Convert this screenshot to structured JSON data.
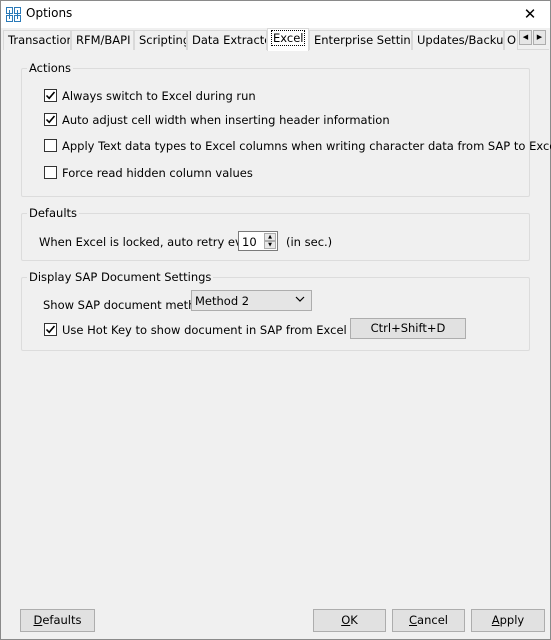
{
  "window": {
    "title": "Options",
    "close_glyph": "✕"
  },
  "tabs": [
    {
      "label": "Transaction"
    },
    {
      "label": "RFM/BAPI"
    },
    {
      "label": "Scripting"
    },
    {
      "label": "Data Extractor"
    },
    {
      "label": "Excel",
      "active": true
    },
    {
      "label": "Enterprise Settings"
    },
    {
      "label": "Updates/Backup"
    },
    {
      "label": "O"
    }
  ],
  "tab_scroll": {
    "left": "◀",
    "right": "▶"
  },
  "actions": {
    "title": "Actions",
    "options": [
      {
        "label": "Always switch to Excel during run",
        "checked": true
      },
      {
        "label": "Auto adjust cell width when inserting header information",
        "checked": true
      },
      {
        "label": "Apply Text data types to Excel columns when writing character data from SAP to Excel",
        "checked": false
      },
      {
        "label": "Force read hidden column values",
        "checked": false
      }
    ]
  },
  "defaults_group": {
    "title": "Defaults",
    "retry_label": "When Excel is locked, auto retry every",
    "retry_value": "10",
    "retry_unit": "(in sec.)"
  },
  "display_sap": {
    "title": "Display SAP Document Settings",
    "method_label": "Show SAP document method",
    "method_value": "Method 2",
    "hotkey_label": "Use Hot Key to show document in SAP from Excel",
    "hotkey_checked": true,
    "hotkey_value": "Ctrl+Shift+D"
  },
  "buttons": {
    "defaults": {
      "prefix": "",
      "mnemonic": "D",
      "rest": "efaults"
    },
    "ok": {
      "prefix": "",
      "mnemonic": "O",
      "rest": "K"
    },
    "cancel": {
      "prefix": "",
      "mnemonic": "C",
      "rest": "ancel"
    },
    "apply": {
      "prefix": "",
      "mnemonic": "A",
      "rest": "pply"
    }
  },
  "icons": {
    "app": "options-grid-icon",
    "check": "checkmark-icon",
    "dropdown": "chevron-down-icon"
  }
}
